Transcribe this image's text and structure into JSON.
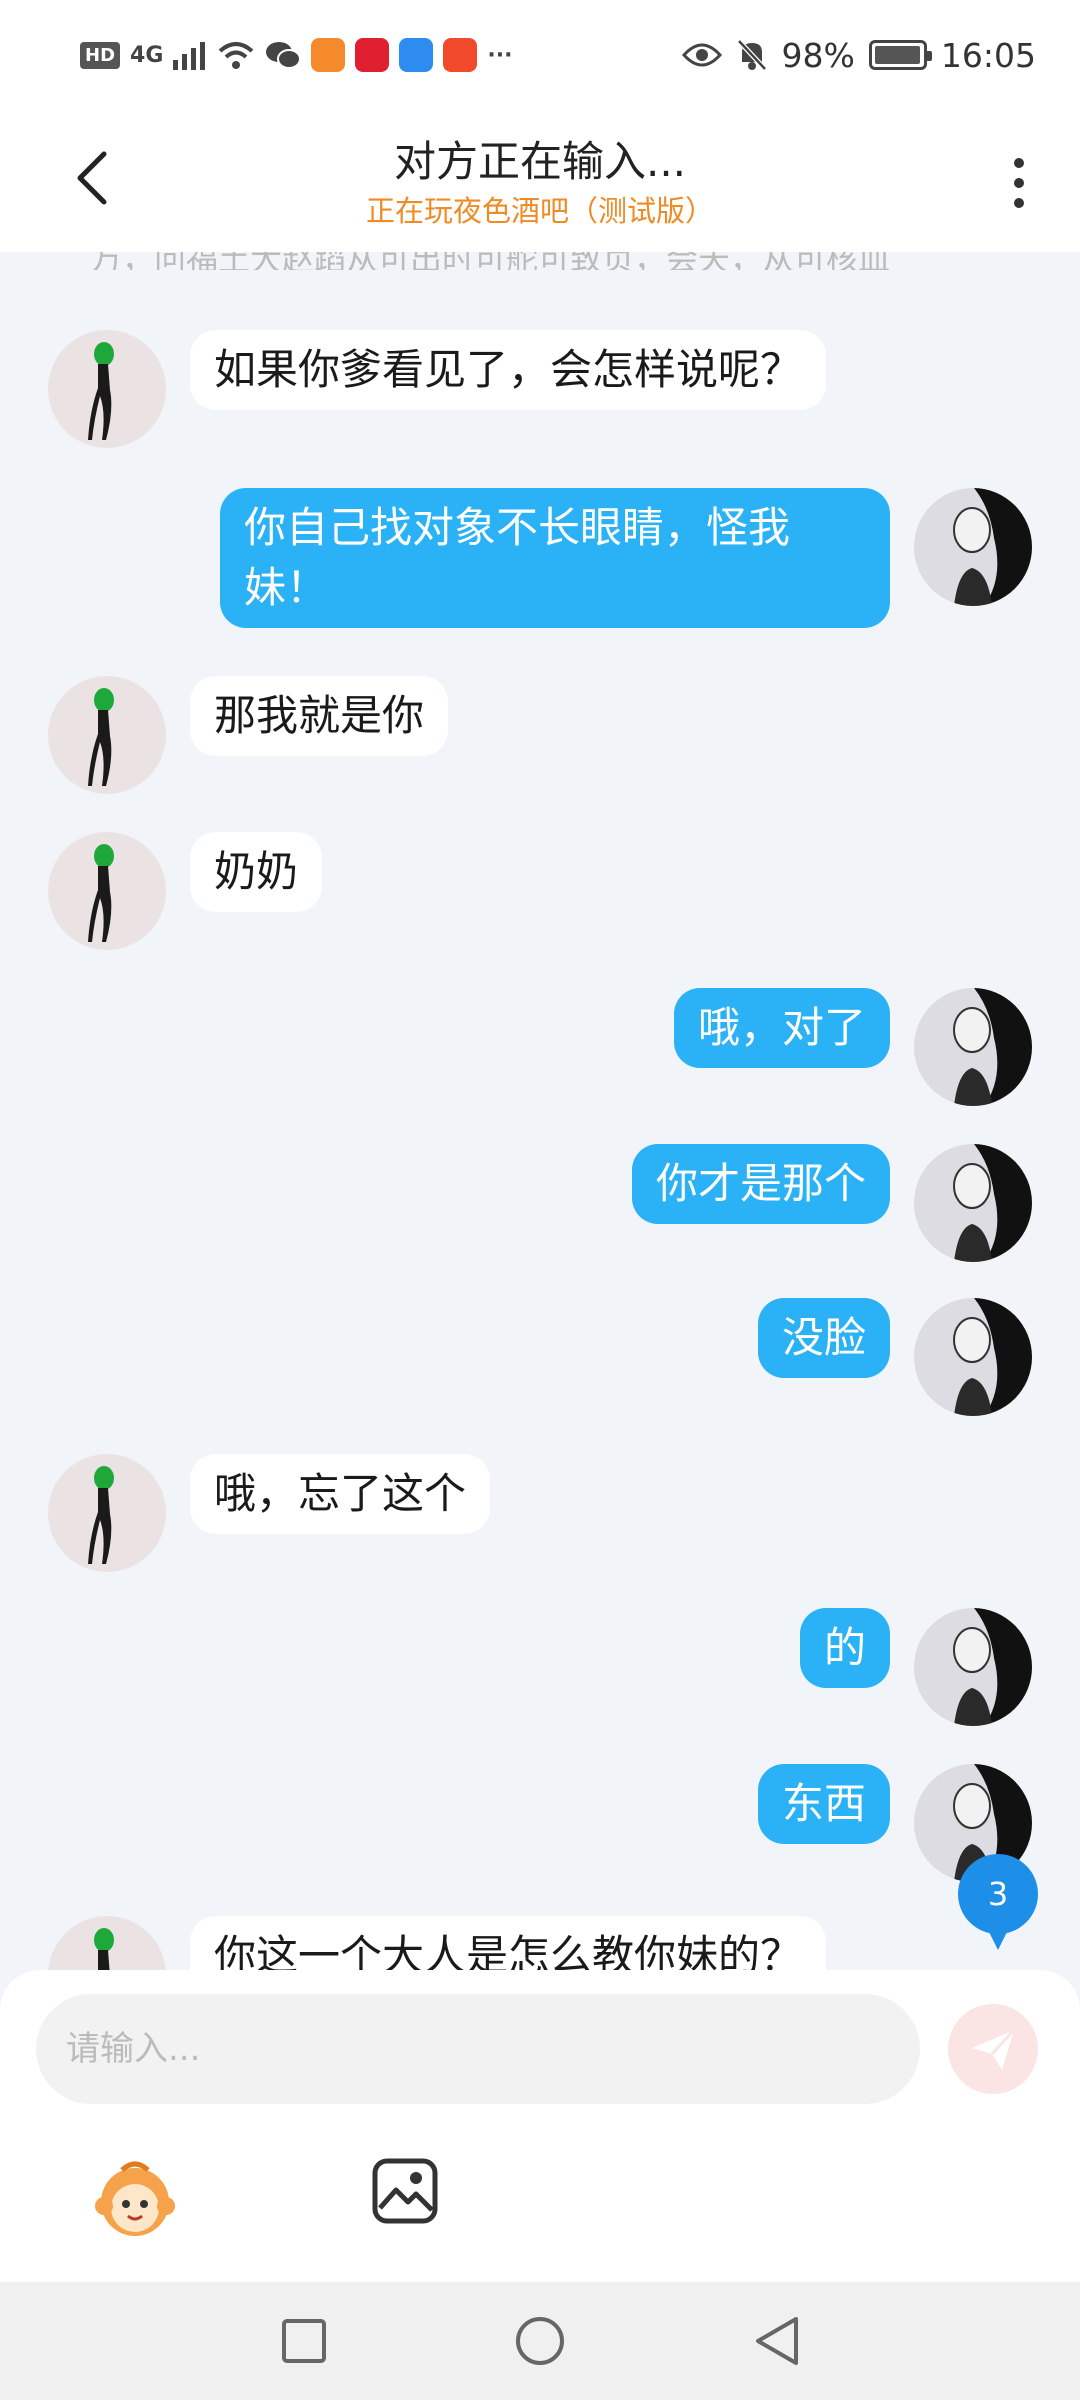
{
  "status_bar": {
    "hd": "HD",
    "network": "4G",
    "more": "···",
    "battery": "98%",
    "time": "16:05",
    "icons": [
      "hd-icon",
      "signal-icon",
      "wifi-icon",
      "wechat-icon",
      "video-app-icon",
      "heart-app-icon",
      "cloud-app-icon",
      "shop-app-icon",
      "eye-icon",
      "mute-icon",
      "battery-icon"
    ]
  },
  "header": {
    "title": "对方正在输入...",
    "subtitle": "正在玩夜色酒吧（测试版）",
    "subtitle_color": "#f08a24",
    "icons": [
      "back-icon",
      "more-icon"
    ]
  },
  "chat": {
    "cut_off_text": "万，问福土大赵蹈从可出时可舵可致页，会天，从可核血",
    "messages": [
      {
        "side": "left",
        "text": "如果你爹看见了，会怎样说呢？"
      },
      {
        "side": "right",
        "text": "你自己找对象不长眼睛，怪我妹！"
      },
      {
        "side": "left",
        "text": "那我就是你"
      },
      {
        "side": "left",
        "text": "奶奶"
      },
      {
        "side": "right",
        "text": "哦，对了"
      },
      {
        "side": "right",
        "text": "你才是那个"
      },
      {
        "side": "right",
        "text": "没脸"
      },
      {
        "side": "left",
        "text": "哦，忘了这个"
      },
      {
        "side": "right",
        "text": "的"
      },
      {
        "side": "right",
        "text": "东西"
      },
      {
        "side": "left",
        "text": "你这一个大人是怎么教你妹的？"
      }
    ],
    "unread_count": "3",
    "colors": {
      "my_bubble": "#2ab1f6",
      "their_bubble": "#ffffff",
      "background": "#f1f4f8"
    }
  },
  "composer": {
    "placeholder": "请输入...",
    "icons": [
      "send-icon",
      "emoji-icon",
      "image-icon"
    ]
  },
  "nav": {
    "icons": [
      "recents-icon",
      "home-icon",
      "back-nav-icon"
    ]
  }
}
